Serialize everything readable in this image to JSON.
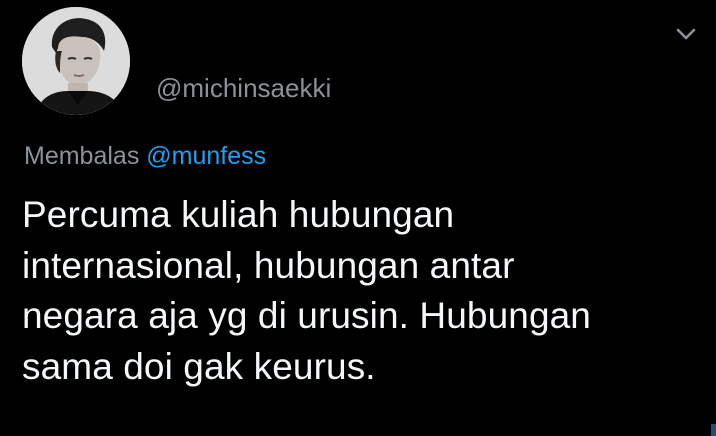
{
  "tweet": {
    "author_handle": "@michinsaekki",
    "reply_prefix": "Membalas",
    "reply_to": "@munfess",
    "text": "Percuma kuliah hubungan\ninternasional, hubungan antar\nnegara aja yg di urusin. Hubungan\nsama doi gak keurus.",
    "menu_icon": "chevron-down-icon"
  },
  "colors": {
    "background": "#000000",
    "secondary_text": "#8b9299",
    "link": "#1da1f2",
    "primary_text": "#f5f8fa"
  }
}
